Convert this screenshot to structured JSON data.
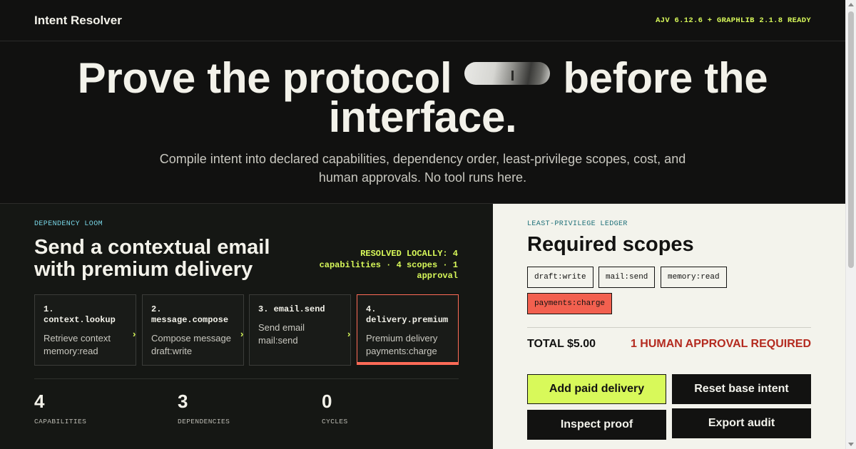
{
  "header": {
    "brand": "Intent Resolver",
    "status": "AJV 6.12.6 + GRAPHLIB 2.1.8 READY"
  },
  "hero": {
    "title_part1": "Prove the protocol",
    "title_part2": "before the",
    "title_part3": "interface.",
    "subtitle": "Compile intent into declared capabilities, dependency order, least-privilege scopes, cost, and human approvals. No tool runs here."
  },
  "loom": {
    "eyebrow": "DEPENDENCY LOOM",
    "title": "Send a contextual email with premium delivery",
    "resolved": "RESOLVED LOCALLY: 4 capabilities · 4 scopes · 1 approval",
    "capabilities": [
      {
        "name": "1. context.lookup",
        "desc_action": "Retrieve context",
        "desc_scope": "memory:read"
      },
      {
        "name": "2. message.compose",
        "desc_action": "Compose message",
        "desc_scope": "draft:write"
      },
      {
        "name": "3. email.send",
        "desc_action": "Send email",
        "desc_scope": "mail:send"
      },
      {
        "name": "4. delivery.premium",
        "desc_action": "Premium delivery",
        "desc_scope": "payments:charge"
      }
    ],
    "arrow": "›",
    "stats": [
      {
        "value": "4",
        "label": "CAPABILITIES"
      },
      {
        "value": "3",
        "label": "DEPENDENCIES"
      },
      {
        "value": "0",
        "label": "CYCLES"
      }
    ]
  },
  "ledger": {
    "eyebrow": "LEAST-PRIVILEGE LEDGER",
    "title": "Required scopes",
    "scopes": [
      "draft:write",
      "mail:send",
      "memory:read",
      "payments:charge"
    ],
    "total": "TOTAL $5.00",
    "approval": "1 HUMAN APPROVAL REQUIRED",
    "buttons": {
      "add_paid": "Add paid delivery",
      "reset": "Reset base intent",
      "inspect": "Inspect proof",
      "export": "Export audit"
    }
  },
  "colors": {
    "accent": "#d8f95a",
    "danger": "#f2604f",
    "approval_text": "#b42a1f",
    "eyebrow_cyan": "#78d6e6"
  }
}
